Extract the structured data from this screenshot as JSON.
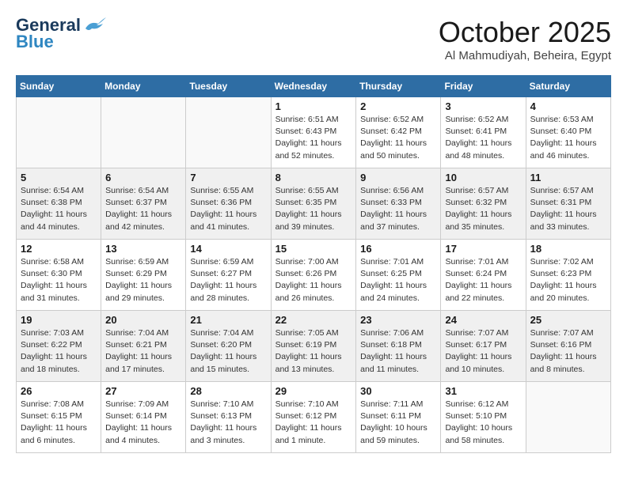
{
  "header": {
    "logo_line1": "General",
    "logo_line2": "Blue",
    "month": "October 2025",
    "location": "Al Mahmudiyah, Beheira, Egypt"
  },
  "weekdays": [
    "Sunday",
    "Monday",
    "Tuesday",
    "Wednesday",
    "Thursday",
    "Friday",
    "Saturday"
  ],
  "weeks": [
    [
      {
        "day": "",
        "info": ""
      },
      {
        "day": "",
        "info": ""
      },
      {
        "day": "",
        "info": ""
      },
      {
        "day": "1",
        "info": "Sunrise: 6:51 AM\nSunset: 6:43 PM\nDaylight: 11 hours\nand 52 minutes."
      },
      {
        "day": "2",
        "info": "Sunrise: 6:52 AM\nSunset: 6:42 PM\nDaylight: 11 hours\nand 50 minutes."
      },
      {
        "day": "3",
        "info": "Sunrise: 6:52 AM\nSunset: 6:41 PM\nDaylight: 11 hours\nand 48 minutes."
      },
      {
        "day": "4",
        "info": "Sunrise: 6:53 AM\nSunset: 6:40 PM\nDaylight: 11 hours\nand 46 minutes."
      }
    ],
    [
      {
        "day": "5",
        "info": "Sunrise: 6:54 AM\nSunset: 6:38 PM\nDaylight: 11 hours\nand 44 minutes."
      },
      {
        "day": "6",
        "info": "Sunrise: 6:54 AM\nSunset: 6:37 PM\nDaylight: 11 hours\nand 42 minutes."
      },
      {
        "day": "7",
        "info": "Sunrise: 6:55 AM\nSunset: 6:36 PM\nDaylight: 11 hours\nand 41 minutes."
      },
      {
        "day": "8",
        "info": "Sunrise: 6:55 AM\nSunset: 6:35 PM\nDaylight: 11 hours\nand 39 minutes."
      },
      {
        "day": "9",
        "info": "Sunrise: 6:56 AM\nSunset: 6:33 PM\nDaylight: 11 hours\nand 37 minutes."
      },
      {
        "day": "10",
        "info": "Sunrise: 6:57 AM\nSunset: 6:32 PM\nDaylight: 11 hours\nand 35 minutes."
      },
      {
        "day": "11",
        "info": "Sunrise: 6:57 AM\nSunset: 6:31 PM\nDaylight: 11 hours\nand 33 minutes."
      }
    ],
    [
      {
        "day": "12",
        "info": "Sunrise: 6:58 AM\nSunset: 6:30 PM\nDaylight: 11 hours\nand 31 minutes."
      },
      {
        "day": "13",
        "info": "Sunrise: 6:59 AM\nSunset: 6:29 PM\nDaylight: 11 hours\nand 29 minutes."
      },
      {
        "day": "14",
        "info": "Sunrise: 6:59 AM\nSunset: 6:27 PM\nDaylight: 11 hours\nand 28 minutes."
      },
      {
        "day": "15",
        "info": "Sunrise: 7:00 AM\nSunset: 6:26 PM\nDaylight: 11 hours\nand 26 minutes."
      },
      {
        "day": "16",
        "info": "Sunrise: 7:01 AM\nSunset: 6:25 PM\nDaylight: 11 hours\nand 24 minutes."
      },
      {
        "day": "17",
        "info": "Sunrise: 7:01 AM\nSunset: 6:24 PM\nDaylight: 11 hours\nand 22 minutes."
      },
      {
        "day": "18",
        "info": "Sunrise: 7:02 AM\nSunset: 6:23 PM\nDaylight: 11 hours\nand 20 minutes."
      }
    ],
    [
      {
        "day": "19",
        "info": "Sunrise: 7:03 AM\nSunset: 6:22 PM\nDaylight: 11 hours\nand 18 minutes."
      },
      {
        "day": "20",
        "info": "Sunrise: 7:04 AM\nSunset: 6:21 PM\nDaylight: 11 hours\nand 17 minutes."
      },
      {
        "day": "21",
        "info": "Sunrise: 7:04 AM\nSunset: 6:20 PM\nDaylight: 11 hours\nand 15 minutes."
      },
      {
        "day": "22",
        "info": "Sunrise: 7:05 AM\nSunset: 6:19 PM\nDaylight: 11 hours\nand 13 minutes."
      },
      {
        "day": "23",
        "info": "Sunrise: 7:06 AM\nSunset: 6:18 PM\nDaylight: 11 hours\nand 11 minutes."
      },
      {
        "day": "24",
        "info": "Sunrise: 7:07 AM\nSunset: 6:17 PM\nDaylight: 11 hours\nand 10 minutes."
      },
      {
        "day": "25",
        "info": "Sunrise: 7:07 AM\nSunset: 6:16 PM\nDaylight: 11 hours\nand 8 minutes."
      }
    ],
    [
      {
        "day": "26",
        "info": "Sunrise: 7:08 AM\nSunset: 6:15 PM\nDaylight: 11 hours\nand 6 minutes."
      },
      {
        "day": "27",
        "info": "Sunrise: 7:09 AM\nSunset: 6:14 PM\nDaylight: 11 hours\nand 4 minutes."
      },
      {
        "day": "28",
        "info": "Sunrise: 7:10 AM\nSunset: 6:13 PM\nDaylight: 11 hours\nand 3 minutes."
      },
      {
        "day": "29",
        "info": "Sunrise: 7:10 AM\nSunset: 6:12 PM\nDaylight: 11 hours\nand 1 minute."
      },
      {
        "day": "30",
        "info": "Sunrise: 7:11 AM\nSunset: 6:11 PM\nDaylight: 10 hours\nand 59 minutes."
      },
      {
        "day": "31",
        "info": "Sunrise: 6:12 AM\nSunset: 5:10 PM\nDaylight: 10 hours\nand 58 minutes."
      },
      {
        "day": "",
        "info": ""
      }
    ]
  ]
}
